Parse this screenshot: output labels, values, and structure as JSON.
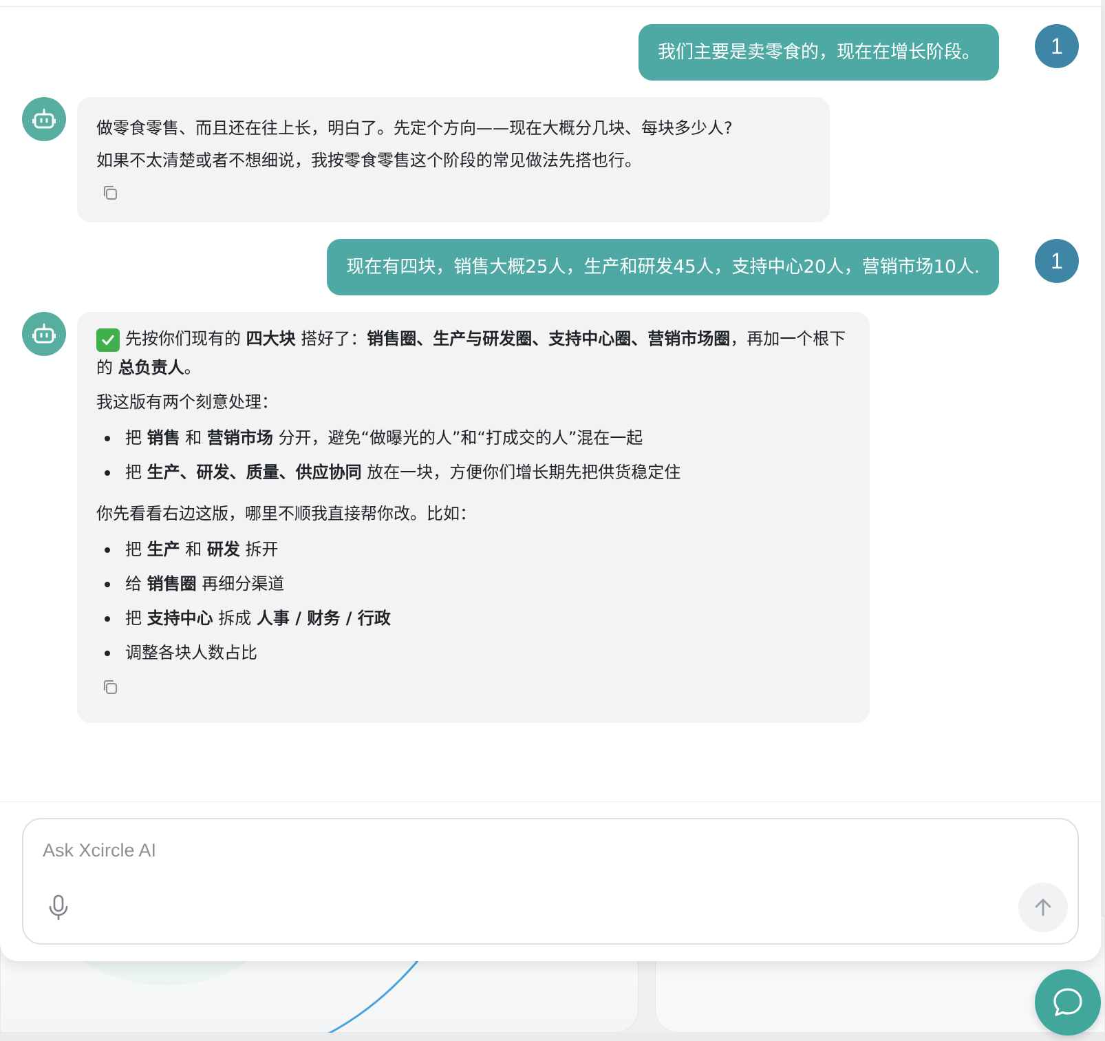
{
  "chat": {
    "messages": [
      {
        "role": "user",
        "avatar": "1",
        "text": "我们主要是卖零食的，现在在增长阶段。"
      },
      {
        "role": "assistant",
        "lines": [
          "做零食零售、而且还在往上长，明白了。先定个方向——现在大概分几块、每块多少人?",
          "如果不太清楚或者不想细说，我按零食零售这个阶段的常见做法先搭也行。"
        ]
      },
      {
        "role": "user",
        "avatar": "1",
        "text": "现在有四块，销售大概25人，生产和研发45人，支持中心20人，营销市场10人."
      },
      {
        "role": "assistant",
        "intro": {
          "t1": "先按你们现有的 ",
          "b1": "四大块",
          "t2": " 搭好了：",
          "b2": "销售圈、生产与研发圈、支持中心圈、营销市场圈",
          "t3": "，再加一个根下的 ",
          "b3": "总负责人",
          "t4": "。"
        },
        "heading1": "我这版有两个刻意处理：",
        "points": [
          {
            "a": "把 ",
            "b": "销售",
            "c": " 和 ",
            "d": "营销市场",
            "e": " 分开，避免“做曝光的人”和“打成交的人”混在一起"
          },
          {
            "a": "把 ",
            "b": "生产、研发、质量、供应协同",
            "e": " 放在一块，方便你们增长期先把供货稳定住"
          }
        ],
        "heading2": "你先看看右边这版，哪里不顺我直接帮你改。比如：",
        "suggestions": [
          {
            "a": "把 ",
            "b": "生产",
            "c": " 和 ",
            "d": "研发",
            "e": " 拆开"
          },
          {
            "a": "给 ",
            "b": "销售圈",
            "e": " 再细分渠道"
          },
          {
            "a": "把 ",
            "b": "支持中心",
            "c": " 拆成 ",
            "d": "人事 / 财务 / 行政"
          },
          {
            "a": "调整各块人数占比"
          }
        ]
      }
    ]
  },
  "input": {
    "placeholder": "Ask Xcircle AI",
    "value": ""
  },
  "icons": {
    "bot_avatar": "robot-icon",
    "copy": "copy-icon",
    "mic": "microphone-icon",
    "send": "arrow-up-icon",
    "fab": "chat-bubble-icon",
    "check": "check-mark-emoji"
  },
  "colors": {
    "user_bubble": "#4ea9a5",
    "user_avatar": "#3f86a6",
    "bot_avatar": "#57ad9f",
    "bot_bubble": "#f3f3f4",
    "fab": "#42a69b"
  }
}
